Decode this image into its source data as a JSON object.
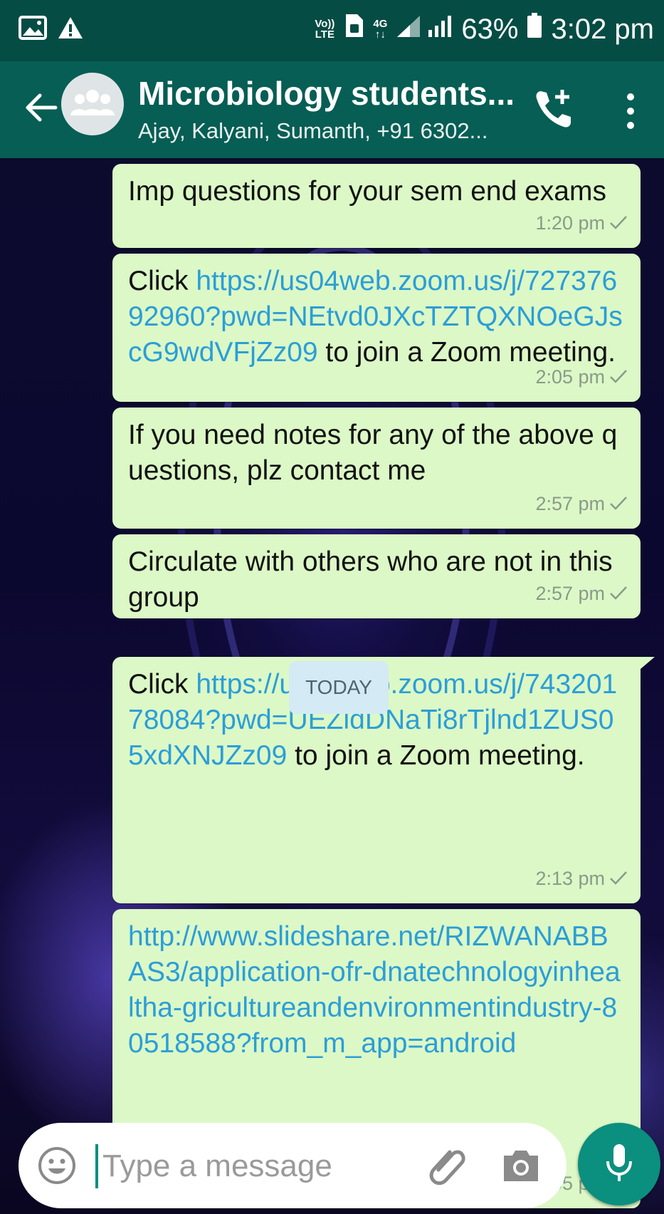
{
  "status_bar": {
    "volte_line1": "Vo))",
    "volte_line2": "LTE",
    "network_line1": "4G",
    "network_line2": "↑↓",
    "battery": "63%",
    "time": "3:02 pm"
  },
  "header": {
    "title": "Microbiology students...",
    "subtitle": "Ajay, Kalyani, Sumanth, +91 6302..."
  },
  "messages": [
    {
      "parts": [
        {
          "text": "Imp questions for your sem end exams",
          "link": false
        }
      ],
      "time": "1:20 pm"
    },
    {
      "parts": [
        {
          "text": "Click ",
          "link": false
        },
        {
          "text": "https://us04web.zoom.us/j/72737692960?pwd=NEtvd0JXcTZTQXNOeGJscG9wdVFjZz09",
          "link": true
        },
        {
          "text": " to join a Zoom meeting.",
          "link": false
        }
      ],
      "time": "2:05 pm"
    },
    {
      "parts": [
        {
          "text": "If you need notes for any of the above questions, plz contact me",
          "link": false
        }
      ],
      "time": "2:57 pm"
    },
    {
      "parts": [
        {
          "text": "Circulate with others who are not in this group",
          "link": false
        }
      ],
      "time": "2:57 pm"
    },
    {
      "parts": [
        {
          "text": "Click ",
          "link": false
        },
        {
          "text": "https://us04web.zoom.us/j/74320178084?pwd=UEZidDNaTi8rTjlnd1ZUS05xdXNJZz09",
          "link": true
        },
        {
          "text": " to join a Zoom meeting.",
          "link": false
        }
      ],
      "time": "2:13 pm"
    },
    {
      "parts": [
        {
          "text": "http://www.slideshare.net/RIZWANABBAS3/application-ofr-dnatechnologyinhealtha-gricultureandenvironmentindustry-80518588?from_m_app=android",
          "link": true
        }
      ],
      "time": "2:55 pm"
    }
  ],
  "day_divider": "TODAY",
  "input": {
    "placeholder": "Type a message"
  },
  "icons": {
    "gallery": "gallery-icon",
    "warning": "warning-icon",
    "back": "arrow-left-icon",
    "group_avatar": "group-icon",
    "add_call": "add-call-icon",
    "menu": "more-vert-icon",
    "emoji": "emoji-icon",
    "attach": "paperclip-icon",
    "camera": "camera-icon",
    "mic": "mic-icon"
  },
  "colors": {
    "header": "#075e54",
    "status_bar": "#054c44",
    "bubble": "#dcf8c6",
    "link": "#2b9ed8",
    "accent": "#0b8f7e"
  }
}
